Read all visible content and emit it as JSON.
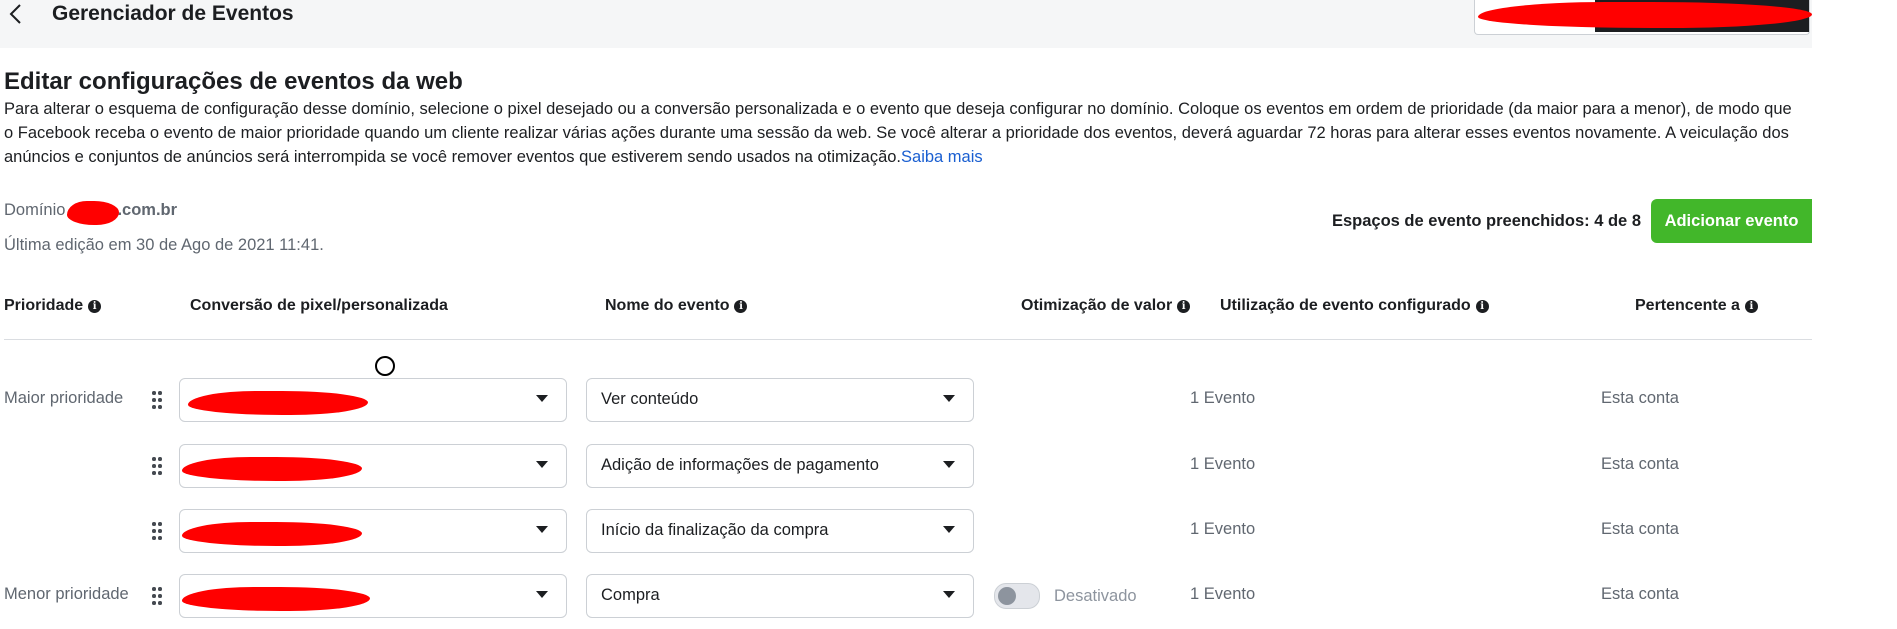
{
  "header": {
    "title": "Gerenciador de Eventos",
    "back_icon": "chevron-left-icon"
  },
  "page": {
    "heading": "Editar configurações de eventos da web",
    "description": "Para alterar o esquema de configuração desse domínio, selecione o pixel desejado ou a conversão personalizada e o evento que deseja configurar no domínio. Coloque os eventos em ordem de prioridade (da maior para a menor), de modo que o Facebook receba o evento de maior prioridade quando um cliente realizar várias ações durante uma sessão da web. Se você alterar a prioridade dos eventos, deverá aguardar 72 horas para alterar esses eventos novamente. A veiculação dos anúncios e conjuntos de anúncios será interrompida se você remover eventos que estiverem sendo usados na otimização.",
    "learn_more": "Saiba mais",
    "domain_label": "Domínio",
    "domain_suffix": ".com.br",
    "last_edit": "Última edição em 30 de Ago de 2021 11:41.",
    "slots": "Espaços de evento preenchidos: 4 de 8",
    "add_button": "Adicionar evento"
  },
  "table": {
    "headers": {
      "priority": "Prioridade",
      "pixel": "Conversão de pixel/personalizada",
      "event": "Nome do evento",
      "value_opt": "Otimização de valor",
      "usage": "Utilização de evento configurado",
      "owner": "Pertencente a"
    },
    "rows": [
      {
        "priority": "Maior prioridade",
        "event": "Ver conteúdo",
        "uses": "1 Evento",
        "owner": "Esta conta"
      },
      {
        "priority": "",
        "event": "Adição de informações de pagamento",
        "uses": "1 Evento",
        "owner": "Esta conta"
      },
      {
        "priority": "",
        "event": "Início da finalização da compra",
        "uses": "1 Evento",
        "owner": "Esta conta"
      },
      {
        "priority": "Menor prioridade",
        "event": "Compra",
        "toggle_label": "Desativado",
        "uses": "1 Evento",
        "owner": "Esta conta"
      }
    ]
  },
  "colors": {
    "accent_green": "#42b72a",
    "link_blue": "#1a5fd1",
    "redaction": "#ff0000"
  }
}
